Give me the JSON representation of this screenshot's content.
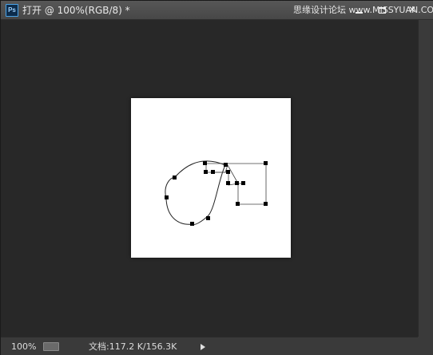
{
  "titlebar": {
    "app_icon_label": "Ps",
    "doc_title": "打开 @ 100%(RGB/8) *",
    "watermark": "思缘设计论坛 www.MISSYUAN.COM",
    "close_label": "✕"
  },
  "statusbar": {
    "zoom": "100%",
    "zoom_pill": "",
    "doc_info": "文档:117.2 K/156.3K"
  },
  "colors": {
    "workspace": "#282828",
    "titlebar": "#4f4f4f",
    "document": "#ffffff",
    "path": "#000000"
  },
  "icons": [
    "photoshop-icon",
    "minimize-icon",
    "maximize-icon",
    "close-icon",
    "status-menu-arrow-icon"
  ]
}
